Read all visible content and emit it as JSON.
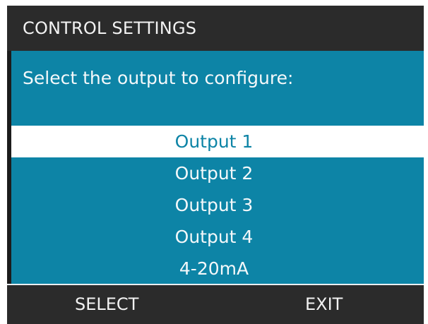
{
  "header": {
    "title": "CONTROL SETTINGS"
  },
  "main": {
    "prompt": "Select the output to configure:",
    "options": [
      {
        "label": "Output 1",
        "selected": true
      },
      {
        "label": "Output 2",
        "selected": false
      },
      {
        "label": "Output 3",
        "selected": false
      },
      {
        "label": "Output 4",
        "selected": false
      },
      {
        "label": "4-20mA",
        "selected": false
      }
    ]
  },
  "softkeys": {
    "left_label": "SELECT",
    "right_label": "EXIT"
  },
  "colors": {
    "screen_background": "#0d84a6",
    "bar_background": "#2b2b2b",
    "highlight_background": "#ffffff",
    "highlight_text": "#0d84a6",
    "text": "#f4f8fa"
  }
}
